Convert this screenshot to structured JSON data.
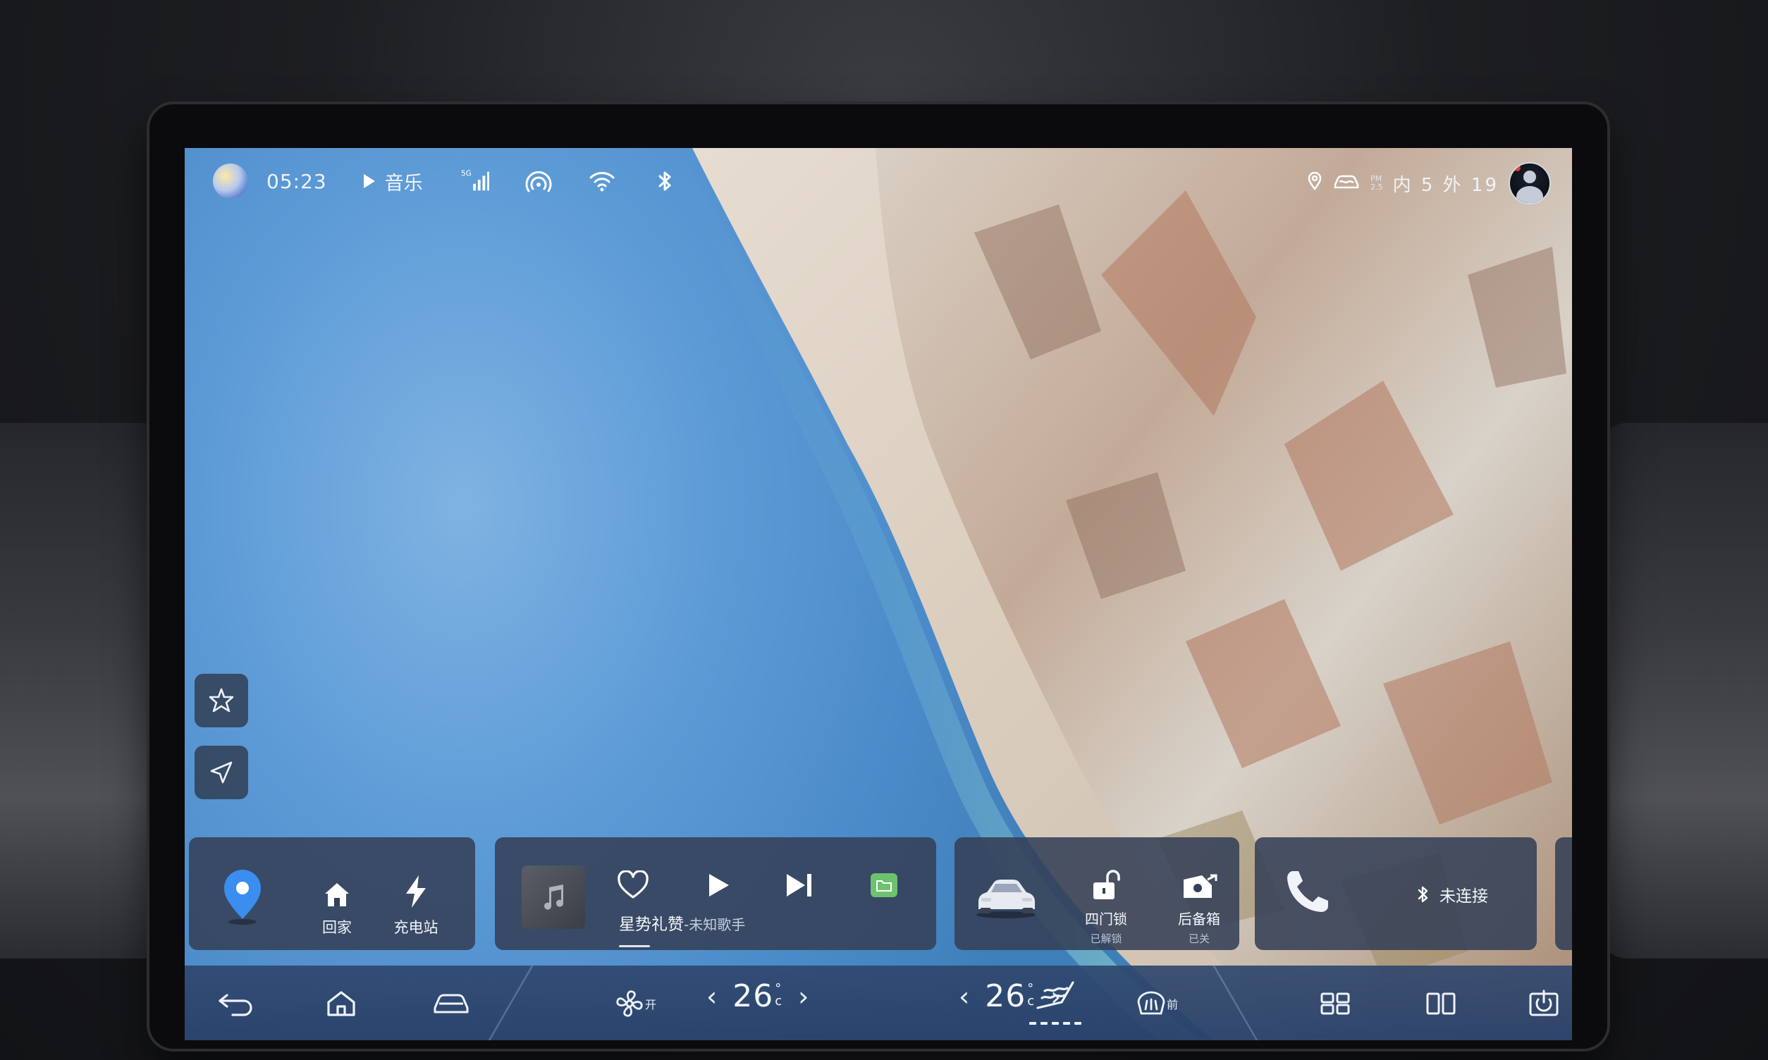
{
  "status_bar": {
    "time": "05:23",
    "music_label": "音乐",
    "network_label": "5G",
    "pm_label_top": "PM",
    "pm_label_bottom": "2.5",
    "temperature_readout": "内 5 外 19",
    "icons": [
      "assistant-orb",
      "signal-5g-icon",
      "hotspot-icon",
      "wifi-icon",
      "bluetooth-icon",
      "location-icon",
      "car-air-icon",
      "avatar"
    ]
  },
  "side_buttons": [
    {
      "name": "favorite-star-button",
      "icon": "star-outline-icon"
    },
    {
      "name": "navigate-button",
      "icon": "navigate-arrow-icon"
    }
  ],
  "nav_card": {
    "home_label": "回家",
    "charge_label": "充电站",
    "icons": [
      "map-pin-icon",
      "home-icon",
      "lightning-icon"
    ]
  },
  "music_card": {
    "song_title": "星势礼赞",
    "artist": "-未知歌手",
    "progress": 0.1,
    "icons": [
      "album-art-icon",
      "heart-icon",
      "play-icon",
      "next-track-icon",
      "folder-icon"
    ]
  },
  "car_card": {
    "locks_label": "四门锁",
    "locks_status": "已解锁",
    "trunk_label": "后备箱",
    "trunk_status": "已关",
    "icons": [
      "car-image",
      "unlock-icon",
      "trunk-icon"
    ]
  },
  "phone_card": {
    "bt_status": "未连接",
    "icons": [
      "phone-icon",
      "bluetooth-icon"
    ]
  },
  "dock": {
    "fan_label": "开",
    "left_temp": "26",
    "right_temp": "26",
    "temp_unit_top": "°",
    "temp_unit_bottom": "c",
    "defrost_label": "前",
    "icons": [
      "back-icon",
      "home-icon",
      "car-icon",
      "fan-icon",
      "chevron-left-icon",
      "chevron-right-icon",
      "seat-heat-icon",
      "defrost-icon",
      "grid-icon",
      "split-view-icon",
      "power-icon"
    ]
  },
  "colors": {
    "lake_blue": "#5d9bd7",
    "card_bg": "#344056",
    "dock_bg": "#30486e",
    "pin_blue": "#3b8df0",
    "folder_green": "#6cc26e",
    "avatar_dot": "#e53b3b"
  }
}
